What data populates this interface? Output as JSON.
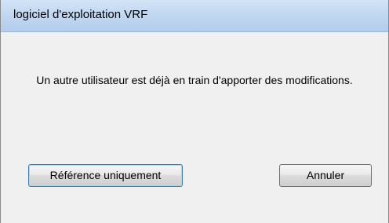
{
  "window": {
    "title": "logiciel d'exploitation VRF"
  },
  "dialog": {
    "message": "Un autre utilisateur est déjà en train d'apporter des modifications."
  },
  "buttons": {
    "reference_label": "Référence uniquement",
    "cancel_label": "Annuler"
  }
}
